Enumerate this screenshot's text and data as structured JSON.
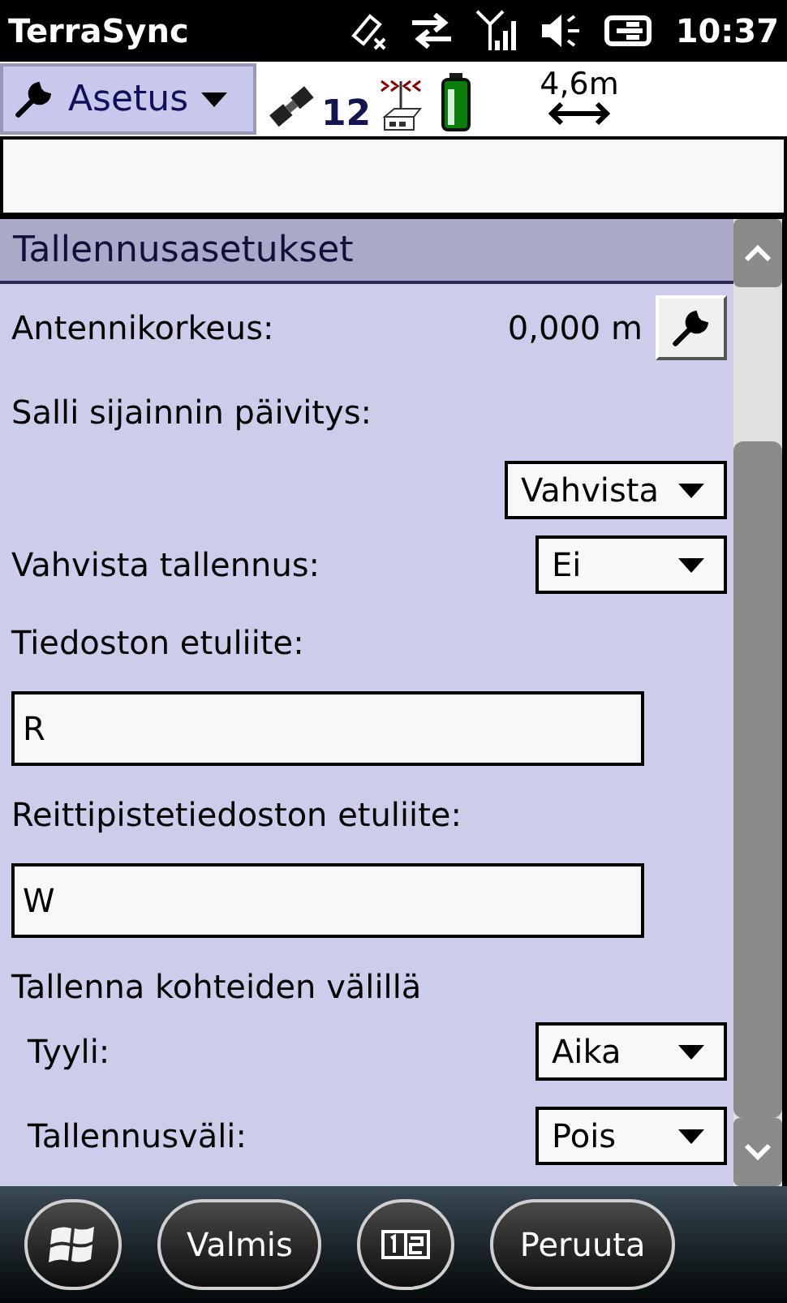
{
  "status_bar": {
    "app_title": "TerraSync",
    "time": "10:37"
  },
  "toolbar": {
    "section_dropdown": "Asetus",
    "satellites": "12",
    "accuracy": "4,6m"
  },
  "settings_panel": {
    "title": "Tallennusasetukset",
    "rows": [
      {
        "kind": "value",
        "label": "Antennikorkeus:",
        "value": "0,000 m"
      },
      {
        "kind": "heading",
        "label": "Salli sijainnin päivitys:"
      },
      {
        "kind": "dropdown",
        "value": "Vahvista"
      },
      {
        "kind": "dropdown",
        "label": "Vahvista tallennus:",
        "value": "Ei"
      },
      {
        "kind": "heading",
        "label": "Tiedoston etuliite:"
      },
      {
        "kind": "field",
        "value": "R"
      },
      {
        "kind": "heading",
        "label": "Reittipistetiedoston etuliite:"
      },
      {
        "kind": "field",
        "value": "W"
      },
      {
        "kind": "heading",
        "label": "Tallenna kohteiden välillä",
        "children": [
          {
            "kind": "dropdown",
            "label": "Tyyli:",
            "value": "Aika"
          },
          {
            "kind": "dropdown",
            "label": "Tallennusväli:",
            "value": "Pois"
          }
        ]
      }
    ]
  },
  "bottom_bar": [
    {
      "kind": "start"
    },
    {
      "kind": "text",
      "label": "Valmis"
    },
    {
      "kind": "input"
    },
    {
      "kind": "text",
      "label": "Peruuta"
    }
  ]
}
